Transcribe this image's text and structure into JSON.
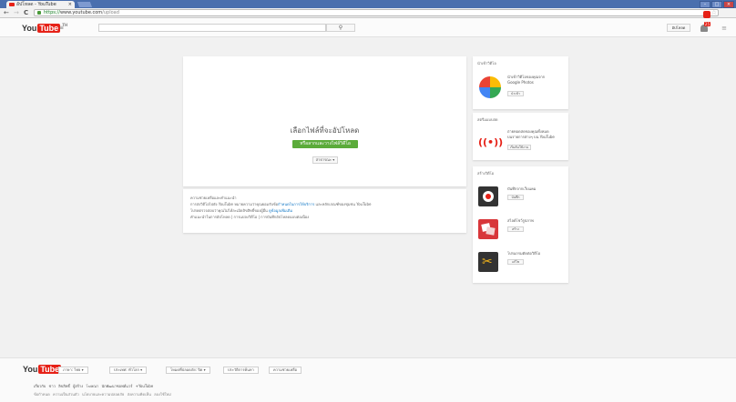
{
  "browser": {
    "tab_title": "อัปโหลด - YouTube",
    "tab_close": "×",
    "url_https": "https://",
    "url_host": "www.youtube.com",
    "url_path": "/upload",
    "back": "←",
    "forward": "→",
    "reload": "C",
    "win_min": "–",
    "win_max": "□",
    "win_close": "×"
  },
  "masthead": {
    "logo_you": "You",
    "logo_tube": "Tube",
    "logo_th": "TH",
    "guide_icon_text": "≡",
    "search_icon_text": "🔍",
    "upload_label": "อัปโหลด",
    "notification_count": "25",
    "avatar_glyph": "≡"
  },
  "upload": {
    "title": "เลือกไฟล์ที่จะอัปโหลด",
    "button_label": "หรือลากและวางไฟล์วิดีโอ",
    "privacy_label": "สาธารณะ ▾"
  },
  "info": {
    "heading": "ความช่วยเหลือและคำแนะนำ",
    "line1_prefix": "การส่งวิดีโอไปยัง YouTube หมายความว่าคุณยอมรับข้อ",
    "line1_link": "กำหนดในการให้บริการ",
    "line1_suffix": " และหลักเกณฑ์ของชุมชน YouTube",
    "line2_prefix": "โปรดตรวจสอบว่าคุณไม่ได้ละเมิดลิขสิทธิ์ของผู้อื่น ",
    "line2_link": "ดูข้อมูลเพิ่มเติม",
    "line3": "คำแนะนำในการอัปโหลด   |   การแปลงวิดีโอ   |   การบันทึกอัปโหลดแบบต่อเนื่อง"
  },
  "sidebar": {
    "import": {
      "heading": "นำเข้าวิดีโอ",
      "text1": "นำเข้าวิดีโอของคุณจาก",
      "text2": "Google Photos",
      "button": "นำเข้า"
    },
    "live": {
      "heading": "สตรีมแบบสด",
      "text1": "ถ่ายทอดสดของคุณทั้งหมด",
      "text2": "บนรายการต่างๆ บน YouTube",
      "button": "เริ่มต้นใช้งาน"
    },
    "create": {
      "heading": "สร้างวิดีโอ",
      "items": [
        {
          "text": "บันทึกจากเว็บแคม",
          "button": "บันทึก"
        },
        {
          "text": "สไลด์โชว์รูปภาพ",
          "button": "สร้าง"
        },
        {
          "text": "โปรแกรมตัดต่อวิดีโอ",
          "button": "แก้ไข"
        }
      ]
    }
  },
  "footer": {
    "logo_you": "You",
    "logo_tube": "Tube",
    "language": "ภาษา: ไทย ▾",
    "location": "ประเทศ: ทั่วโลก ▾",
    "restricted": "โหมดที่ปลอดภัย: ปิด ▾",
    "history": "ประวัติการค้นหา",
    "help": "ความช่วยเหลือ",
    "links1": "เกี่ยวกับ   ข่าว   ลิขสิทธิ์   ผู้สร้าง   โฆษณา   นักพัฒนาซอฟต์แวร์   +YouTube",
    "links2": "ข้อกำหนด   ความเป็นส่วนตัว   นโยบายและความปลอดภัย   ส่งความคิดเห็น   ลองใช้ใหม่"
  },
  "colors": {
    "brand_red": "#e62117",
    "upload_green": "#5bab3a",
    "link_blue": "#167ac6",
    "page_bg": "#f1f1f1"
  }
}
